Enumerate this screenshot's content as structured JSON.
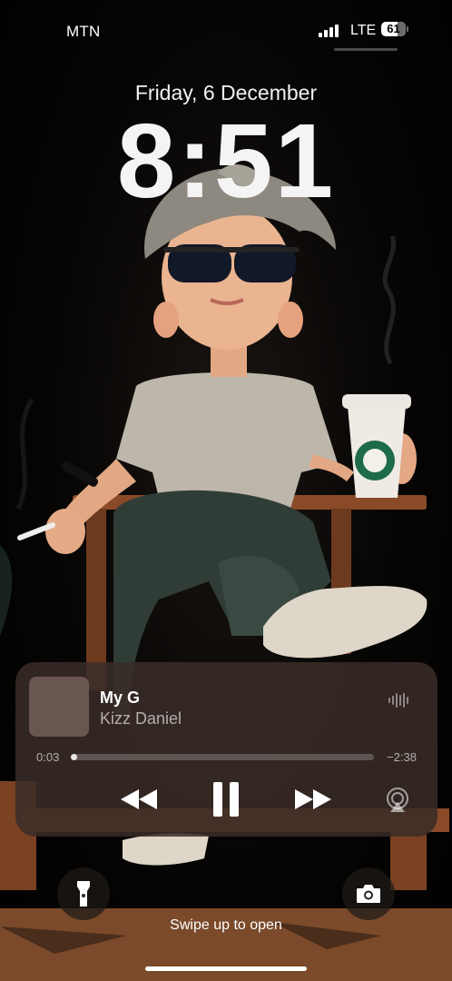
{
  "status_bar": {
    "carrier": "MTN",
    "network": "LTE",
    "battery_level": "61",
    "signal_bars": 4
  },
  "lock_screen": {
    "date": "Friday, 6 December",
    "time": "8:51",
    "swipe_hint": "Swipe up to open"
  },
  "now_playing": {
    "title": "My G",
    "artist": "Kizz Daniel",
    "elapsed": "0:03",
    "remaining": "−2:38",
    "progress_fraction": 0.015
  },
  "icons": {
    "waveform": "waveform-icon",
    "rewind": "rewind-icon",
    "pause": "pause-icon",
    "forward": "fast-forward-icon",
    "airplay": "airplay-icon",
    "flashlight": "flashlight-icon",
    "camera": "camera-icon"
  },
  "colors": {
    "widget_background": "#3a2c28",
    "text_primary": "#ffffff",
    "text_secondary": "#9e9490"
  }
}
